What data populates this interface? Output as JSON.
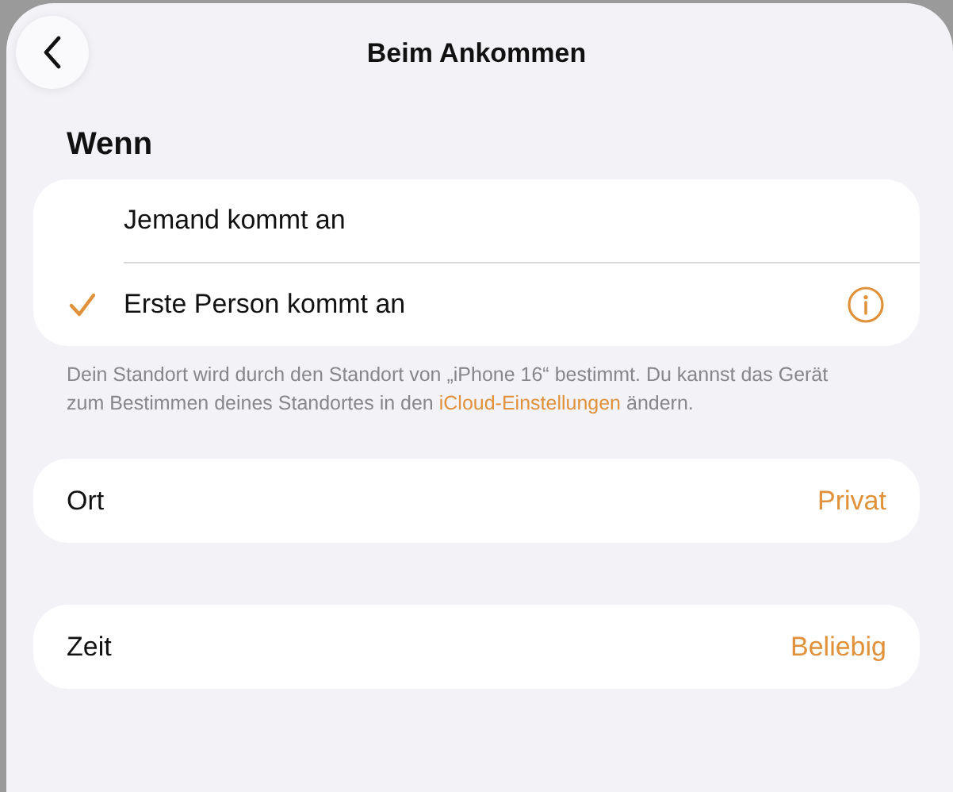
{
  "header": {
    "title": "Beim Ankommen"
  },
  "section": {
    "title": "Wenn",
    "options": [
      {
        "label": "Jemand kommt an",
        "selected": false,
        "info": false
      },
      {
        "label": "Erste Person kommt an",
        "selected": true,
        "info": true
      }
    ],
    "footnote": {
      "text": "Dein Standort wird durch den Standort von „iPhone 16“ bestimmt. Du kannst das Gerät zum Bestimmen deines Standortes in den",
      "link": "iCloud-Einstellungen",
      "after": "ändern."
    }
  },
  "settings": [
    {
      "label": "Ort",
      "value": "Privat"
    },
    {
      "label": "Zeit",
      "value": "Beliebig"
    }
  ]
}
